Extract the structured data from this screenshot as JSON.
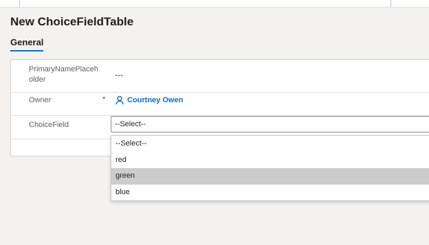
{
  "form": {
    "title": "New ChoiceFieldTable",
    "tabs": [
      {
        "label": "General",
        "selected": true
      }
    ]
  },
  "fields": {
    "primary_name": {
      "label": "PrimaryNamePlaceholder",
      "value": "---"
    },
    "owner": {
      "label": "Owner",
      "required_marker": "*",
      "value": "Courtney Owen"
    },
    "choice": {
      "label": "ChoiceField",
      "value": "--Select--"
    }
  },
  "dropdown": {
    "options": [
      "--Select--",
      "red",
      "green",
      "blue"
    ],
    "highlighted": "green"
  },
  "colors": {
    "accent": "#0f6cbd",
    "required": "#a4262c",
    "hover": "#cccccc"
  },
  "icons": {
    "owner": "person-icon"
  }
}
